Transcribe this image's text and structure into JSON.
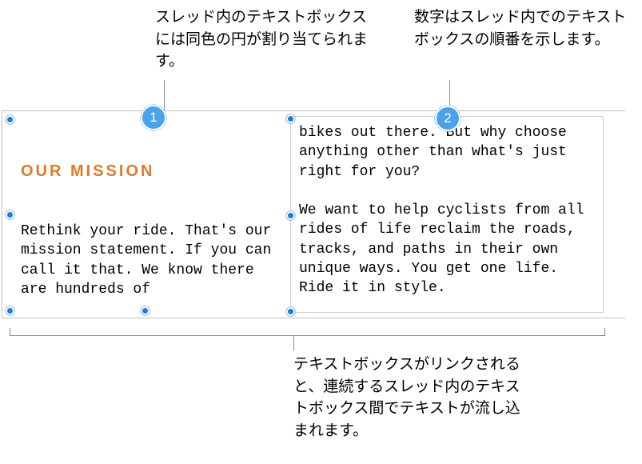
{
  "callouts": {
    "top_left": "スレッド内のテキストボックスには同色の円が割り当てられます。",
    "top_right": "数字はスレッド内でのテキストボックスの順番を示します。",
    "bottom": "テキストボックスがリンクされると、連続するスレッド内のテキストボックス間でテキストが流し込まれます。"
  },
  "textbox1": {
    "badge": "1",
    "heading": "OUR MISSION",
    "body": "Rethink your ride. That's our mission statement. If you can call it that. We know there are hundreds of"
  },
  "textbox2": {
    "badge": "2",
    "body_p1": "bikes out there. But why choose anything other than what's just right for you?",
    "body_p2": "We want to help cyclists from all rides of life reclaim the roads, tracks, and paths in their own unique ways. You get one life. Ride it in style."
  }
}
